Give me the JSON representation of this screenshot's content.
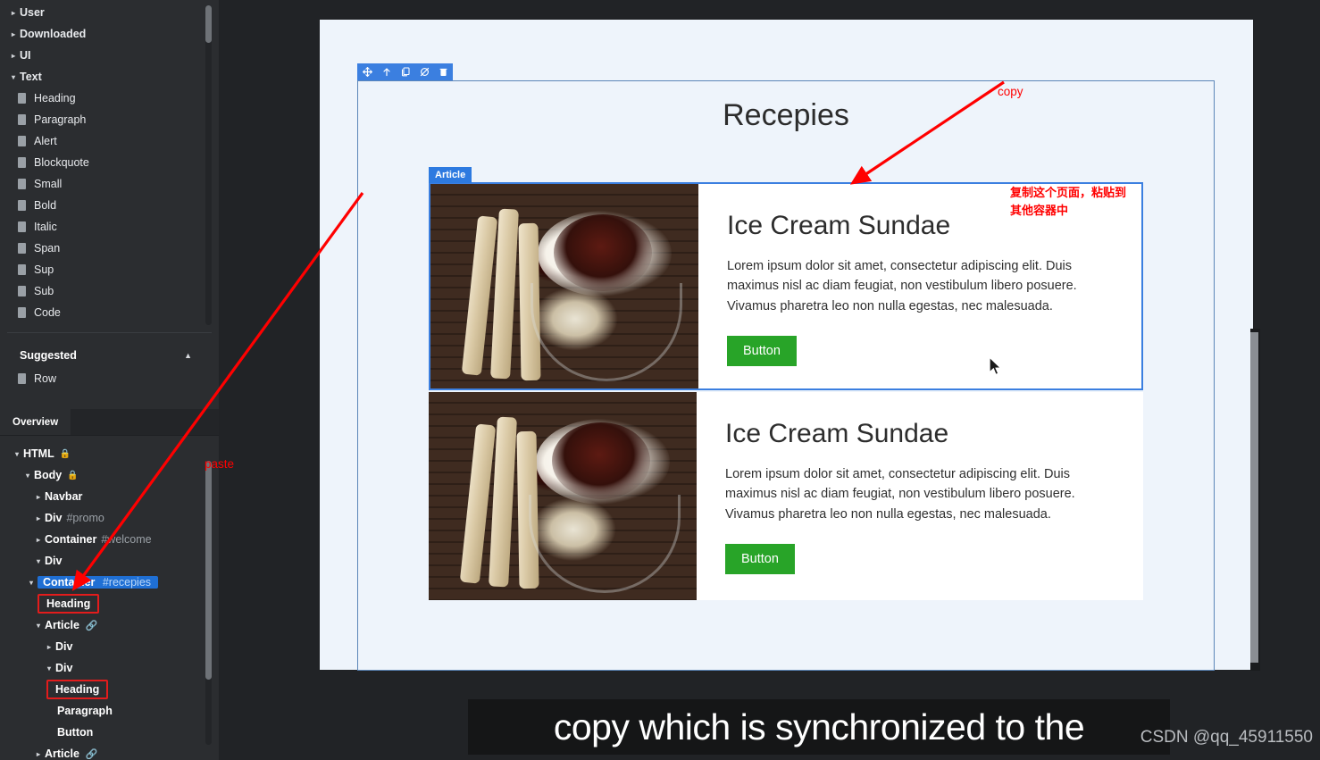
{
  "blocks_panel": {
    "categories": [
      {
        "label": "User",
        "expanded": false
      },
      {
        "label": "Downloaded",
        "expanded": false
      },
      {
        "label": "UI",
        "expanded": false
      },
      {
        "label": "Text",
        "expanded": true
      }
    ],
    "text_blocks": [
      {
        "label": "Heading"
      },
      {
        "label": "Paragraph"
      },
      {
        "label": "Alert"
      },
      {
        "label": "Blockquote"
      },
      {
        "label": "Small"
      },
      {
        "label": "Bold"
      },
      {
        "label": "Italic"
      },
      {
        "label": "Span"
      },
      {
        "label": "Sup"
      },
      {
        "label": "Sub"
      },
      {
        "label": "Code"
      }
    ],
    "suggested": {
      "title": "Suggested",
      "collapse_icon": "chevron-up-icon",
      "items": [
        {
          "label": "Row"
        }
      ]
    }
  },
  "overview_panel": {
    "tabs": [
      {
        "label": "Overview",
        "active": true
      }
    ],
    "tree": [
      {
        "label": "HTML",
        "id": "",
        "indent": 0,
        "caret": "open",
        "lock": true,
        "link": false,
        "selected": false,
        "highlight": false
      },
      {
        "label": "Body",
        "id": "",
        "indent": 1,
        "caret": "open",
        "lock": true,
        "link": false,
        "selected": false,
        "highlight": false
      },
      {
        "label": "Navbar",
        "id": "",
        "indent": 2,
        "caret": "closed",
        "lock": false,
        "link": false,
        "selected": false,
        "highlight": false
      },
      {
        "label": "Div",
        "id": "#promo",
        "indent": 2,
        "caret": "closed",
        "lock": false,
        "link": false,
        "selected": false,
        "highlight": false
      },
      {
        "label": "Container",
        "id": "#welcome",
        "indent": 2,
        "caret": "closed",
        "lock": false,
        "link": false,
        "selected": false,
        "highlight": false
      },
      {
        "label": "Div",
        "id": "",
        "indent": 2,
        "caret": "open",
        "lock": false,
        "link": false,
        "selected": false,
        "highlight": false
      },
      {
        "label": "Container",
        "id": "#recepies",
        "indent": 3,
        "caret": "open",
        "lock": false,
        "link": false,
        "selected": true,
        "highlight": false
      },
      {
        "label": "Heading",
        "id": "",
        "indent": 4,
        "caret": "none",
        "lock": false,
        "link": false,
        "selected": false,
        "highlight": true
      },
      {
        "label": "Article",
        "id": "",
        "indent": 4,
        "caret": "open",
        "lock": false,
        "link": true,
        "selected": false,
        "highlight": false
      },
      {
        "label": "Div",
        "id": "",
        "indent": 5,
        "caret": "closed",
        "lock": false,
        "link": false,
        "selected": false,
        "highlight": false
      },
      {
        "label": "Div",
        "id": "",
        "indent": 5,
        "caret": "open",
        "lock": false,
        "link": false,
        "selected": false,
        "highlight": false
      },
      {
        "label": "Heading",
        "id": "",
        "indent": 6,
        "caret": "none",
        "lock": false,
        "link": false,
        "selected": false,
        "highlight": true
      },
      {
        "label": "Paragraph",
        "id": "",
        "indent": 6,
        "caret": "none",
        "lock": false,
        "link": false,
        "selected": false,
        "highlight": false
      },
      {
        "label": "Button",
        "id": "",
        "indent": 6,
        "caret": "none",
        "lock": false,
        "link": false,
        "selected": false,
        "highlight": false
      },
      {
        "label": "Article",
        "id": "",
        "indent": 4,
        "caret": "closed",
        "lock": false,
        "link": true,
        "selected": false,
        "highlight": false
      }
    ]
  },
  "element_toolbar": {
    "icons": [
      {
        "name": "move-icon",
        "title": "Move"
      },
      {
        "name": "select-parent-icon",
        "title": "Select parent"
      },
      {
        "name": "copy-icon",
        "title": "Copy"
      },
      {
        "name": "hide-icon",
        "title": "Toggle visibility"
      },
      {
        "name": "delete-icon",
        "title": "Delete"
      }
    ]
  },
  "canvas": {
    "page_heading": "Recepies",
    "selected_badge": "Article",
    "cards": [
      {
        "title": "Ice Cream Sundae",
        "text": "Lorem ipsum dolor sit amet, consectetur adipiscing elit. Duis maximus nisl ac diam feugiat, non vestibulum libero posuere. Vivamus pharetra leo non nulla egestas, nec malesuada.",
        "button": "Button",
        "selected": true
      },
      {
        "title": "Ice Cream Sundae",
        "text": "Lorem ipsum dolor sit amet, consectetur adipiscing elit. Duis maximus nisl ac diam feugiat, non vestibulum libero posuere. Vivamus pharetra leo non nulla egestas, nec malesuada.",
        "button": "Button",
        "selected": false
      }
    ]
  },
  "annotations": {
    "copy_label": "copy",
    "paste_label": "paste",
    "chinese_note_line1": "复制这个页面，粘贴到",
    "chinese_note_line2": "其他容器中",
    "arrow_color": "#ff0000"
  },
  "subtitle": {
    "text": "copy which is synchronized to the"
  },
  "watermark": {
    "text": "CSDN @qq_45911550"
  },
  "colors": {
    "panel_bg": "#2b2d30",
    "canvas_bg": "#212326",
    "page_bg": "#eef4fb",
    "accent_blue": "#2d7ae0",
    "selection_blue": "#1f6fd4",
    "button_green": "#28a428",
    "annotation_red": "#ff0000"
  }
}
